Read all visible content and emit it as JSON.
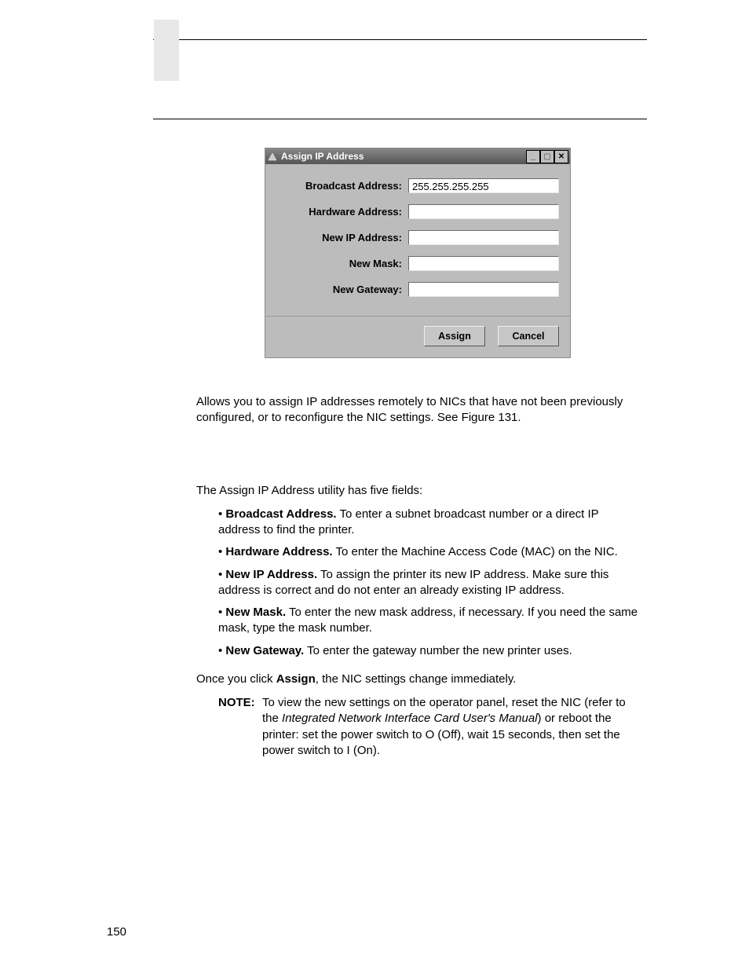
{
  "page_number": "150",
  "dialog": {
    "title": "Assign IP Address",
    "fields": {
      "broadcast": {
        "label": "Broadcast Address:",
        "value": "255.255.255.255"
      },
      "hardware": {
        "label": "Hardware Address:",
        "value": ""
      },
      "new_ip": {
        "label": "New IP Address:",
        "value": ""
      },
      "new_mask": {
        "label": "New Mask:",
        "value": ""
      },
      "new_gw": {
        "label": "New Gateway:",
        "value": ""
      }
    },
    "buttons": {
      "assign": "Assign",
      "cancel": "Cancel"
    }
  },
  "body": {
    "intro": "Allows you to assign IP addresses remotely to NICs that have not been previously configured, or to reconfigure the NIC settings. See Figure 131.",
    "fields_intro": "The Assign IP Address utility has five fields:",
    "b1_lead": "Broadcast Address.",
    "b1_rest": " To enter a subnet broadcast number or a direct IP address to find the printer.",
    "b2_lead": "Hardware Address.",
    "b2_rest": " To enter the Machine Access Code (MAC) on the NIC.",
    "b3_lead": "New IP Address.",
    "b3_rest": " To assign the printer its new IP address. Make sure this address is correct and do not enter an already existing IP address.",
    "b4_lead": "New Mask.",
    "b4_rest": " To enter the new mask address, if necessary. If you need the same mask, type the mask number.",
    "b5_lead": "New Gateway.",
    "b5_rest": " To enter the gateway number the new printer uses.",
    "once_pre": "Once you click ",
    "once_bold": "Assign",
    "once_post": ", the NIC settings change immediately.",
    "note_label": "NOTE:",
    "note_pre": "To view the new settings on the operator panel, reset the NIC (refer to the ",
    "note_italic": "Integrated Network Interface Card User's Manual",
    "note_post": ") or reboot the printer: set the power switch to O (Off), wait 15 seconds, then set the power switch to I (On)."
  }
}
